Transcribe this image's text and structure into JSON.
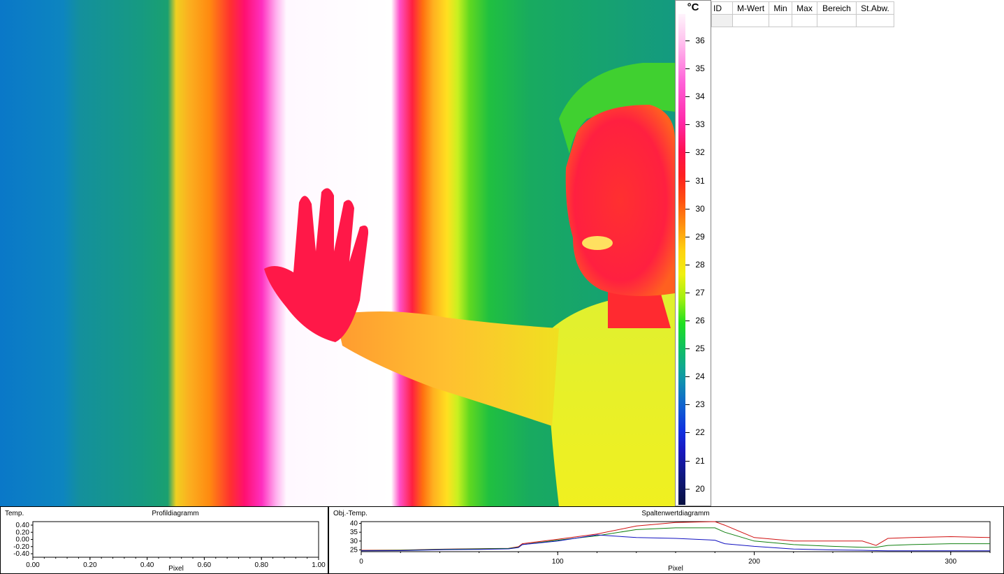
{
  "scale": {
    "unit": "°C",
    "labels": [
      "36",
      "35",
      "34",
      "33",
      "32",
      "31",
      "30",
      "29",
      "28",
      "27",
      "26",
      "25",
      "24",
      "23",
      "22",
      "21",
      "20"
    ]
  },
  "stats_table": {
    "headers": [
      "ID",
      "M-Wert",
      "Min",
      "Max",
      "Bereich",
      "St.Abw."
    ],
    "rows": [
      [
        "",
        "",
        "",
        "",
        "",
        ""
      ]
    ]
  },
  "profile_chart": {
    "ylabel": "Temp.",
    "title": "Profildiagramm",
    "xlabel": "Pixel",
    "y_ticks": [
      "0.40",
      "0.20",
      "0.00",
      "-0.20",
      "-0.40"
    ],
    "x_ticks": [
      "0.00",
      "0.20",
      "0.40",
      "0.60",
      "0.80",
      "1.00"
    ]
  },
  "column_chart": {
    "ylabel": "Obj.-Temp.",
    "title": "Spaltenwertdiagramm",
    "xlabel": "Pixel",
    "y_ticks": [
      "40",
      "35",
      "30",
      "25"
    ],
    "x_ticks": [
      "0",
      "100",
      "200",
      "300"
    ]
  },
  "chart_data": [
    {
      "type": "line",
      "title": "Profildiagramm",
      "xlabel": "Pixel",
      "ylabel": "Temp.",
      "xlim": [
        0,
        1
      ],
      "ylim": [
        -0.4,
        0.4
      ],
      "series": []
    },
    {
      "type": "line",
      "title": "Spaltenwertdiagramm",
      "xlabel": "Pixel",
      "ylabel": "Obj.-Temp.",
      "xlim": [
        0,
        320
      ],
      "ylim": [
        24,
        41
      ],
      "x": [
        0,
        20,
        40,
        60,
        75,
        80,
        82,
        100,
        120,
        140,
        160,
        180,
        185,
        200,
        220,
        240,
        255,
        262,
        268,
        280,
        300,
        320
      ],
      "series": [
        {
          "color": "#d01010",
          "values": [
            24.8,
            24.9,
            25.4,
            25.7,
            25.9,
            26.8,
            28.5,
            31,
            34,
            38.5,
            40.5,
            41,
            39,
            32,
            30,
            30,
            30,
            27.5,
            31.5,
            32,
            32.5,
            32
          ]
        },
        {
          "color": "#108010",
          "values": [
            24.6,
            24.8,
            25.3,
            25.6,
            25.8,
            26.5,
            28,
            30.5,
            33,
            36.5,
            37.5,
            37.5,
            35,
            30,
            28,
            27,
            26.5,
            26.5,
            27.5,
            28,
            28.5,
            28.5
          ]
        },
        {
          "color": "#1010c0",
          "values": [
            24.5,
            24.6,
            25.1,
            25.3,
            25.6,
            26.3,
            28,
            30,
            33.5,
            32,
            31.5,
            30.5,
            28.5,
            27,
            25.5,
            25,
            24.8,
            24.6,
            24.5,
            24.5,
            24.5,
            24.5
          ]
        }
      ]
    }
  ]
}
